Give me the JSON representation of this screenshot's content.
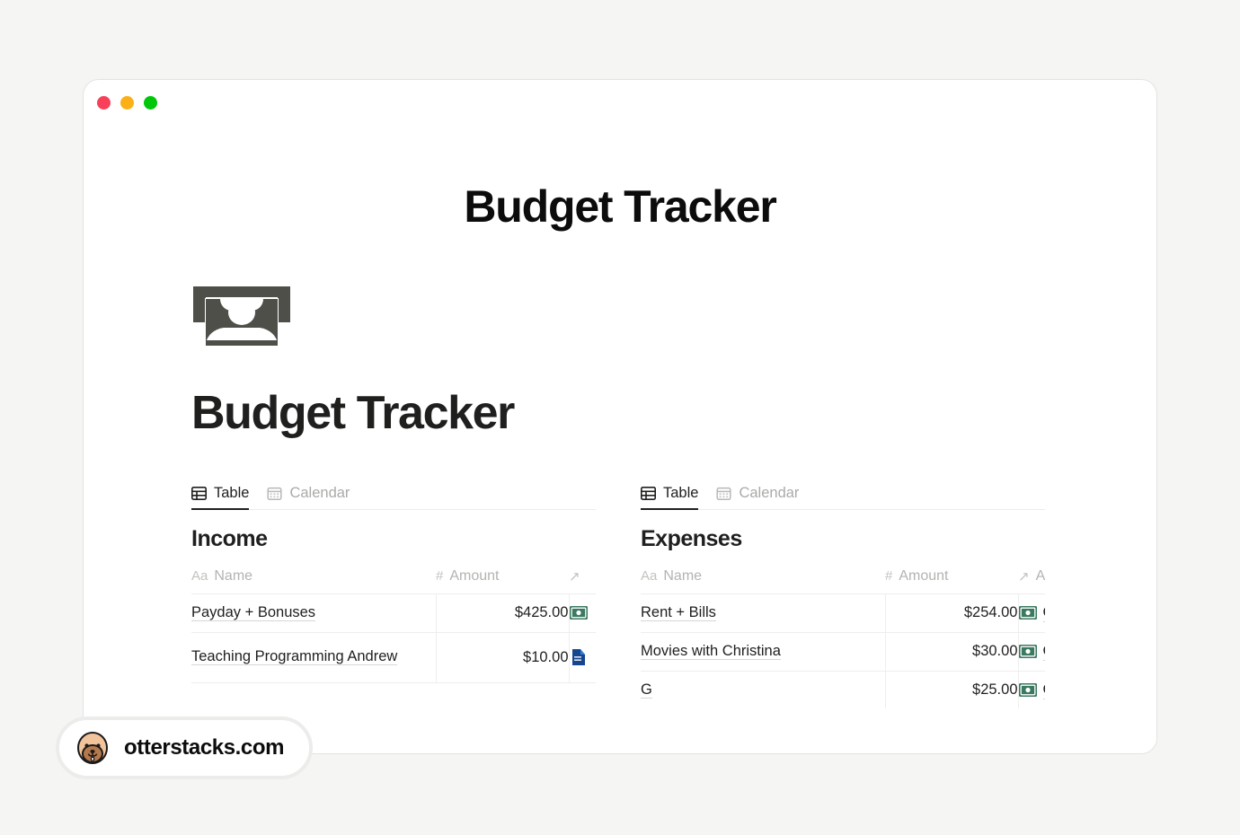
{
  "window": {
    "traffic_lights": [
      {
        "name": "close",
        "color": "#f8405a"
      },
      {
        "name": "minimize",
        "color": "#fbb018"
      },
      {
        "name": "maximize",
        "color": "#00c70a"
      }
    ]
  },
  "hero": {
    "title": "Budget Tracker"
  },
  "doc": {
    "icon": "banknote-icon",
    "title": "Budget Tracker"
  },
  "databases": [
    {
      "id": "income",
      "title": "Income",
      "tabs": [
        {
          "label": "Table",
          "icon": "table-icon",
          "active": true
        },
        {
          "label": "Calendar",
          "icon": "calendar-icon",
          "active": false
        }
      ],
      "columns": [
        {
          "label": "Name",
          "type_glyph": "Aa",
          "type": "title"
        },
        {
          "label": "Amount",
          "type_glyph": "#",
          "type": "number"
        },
        {
          "label": "",
          "type_glyph": "↗",
          "type": "relation"
        }
      ],
      "rows": [
        {
          "name": "Payday + Bonuses",
          "amount": "$425.00",
          "account": "",
          "account_icon": "money-icon",
          "tall": false
        },
        {
          "name": "Teaching Programming Andrew",
          "amount": "$10.00",
          "account": "",
          "account_icon": "bank-icon",
          "tall": true
        }
      ]
    },
    {
      "id": "expenses",
      "title": "Expenses",
      "tabs": [
        {
          "label": "Table",
          "icon": "table-icon",
          "active": true
        },
        {
          "label": "Calendar",
          "icon": "calendar-icon",
          "active": false
        }
      ],
      "columns": [
        {
          "label": "Name",
          "type_glyph": "Aa",
          "type": "title"
        },
        {
          "label": "Amount",
          "type_glyph": "#",
          "type": "number"
        },
        {
          "label": "Acc",
          "type_glyph": "↗",
          "type": "relation"
        }
      ],
      "rows": [
        {
          "name": "Rent + Bills",
          "amount": "$254.00",
          "account": "Ca",
          "account_icon": "money-icon",
          "tall": false
        },
        {
          "name": "Movies with Christina",
          "amount": "$30.00",
          "account": "Ca",
          "account_icon": "money-icon",
          "tall": false
        },
        {
          "name": "G",
          "amount": "$25.00",
          "account": "Ca",
          "account_icon": "money-icon",
          "tall": false
        }
      ]
    }
  ],
  "watermark": {
    "text": "otterstacks.com",
    "icon": "otter-avatar"
  },
  "colors": {
    "page_background": "#f5f5f3",
    "window_background": "#ffffff",
    "text_primary": "#1f1f1e",
    "text_muted": "#b3b3b0",
    "accent_money_green": "#3c7a60",
    "accent_bank_blue": "#17468f",
    "doc_icon_gray": "#4f4f4a"
  }
}
